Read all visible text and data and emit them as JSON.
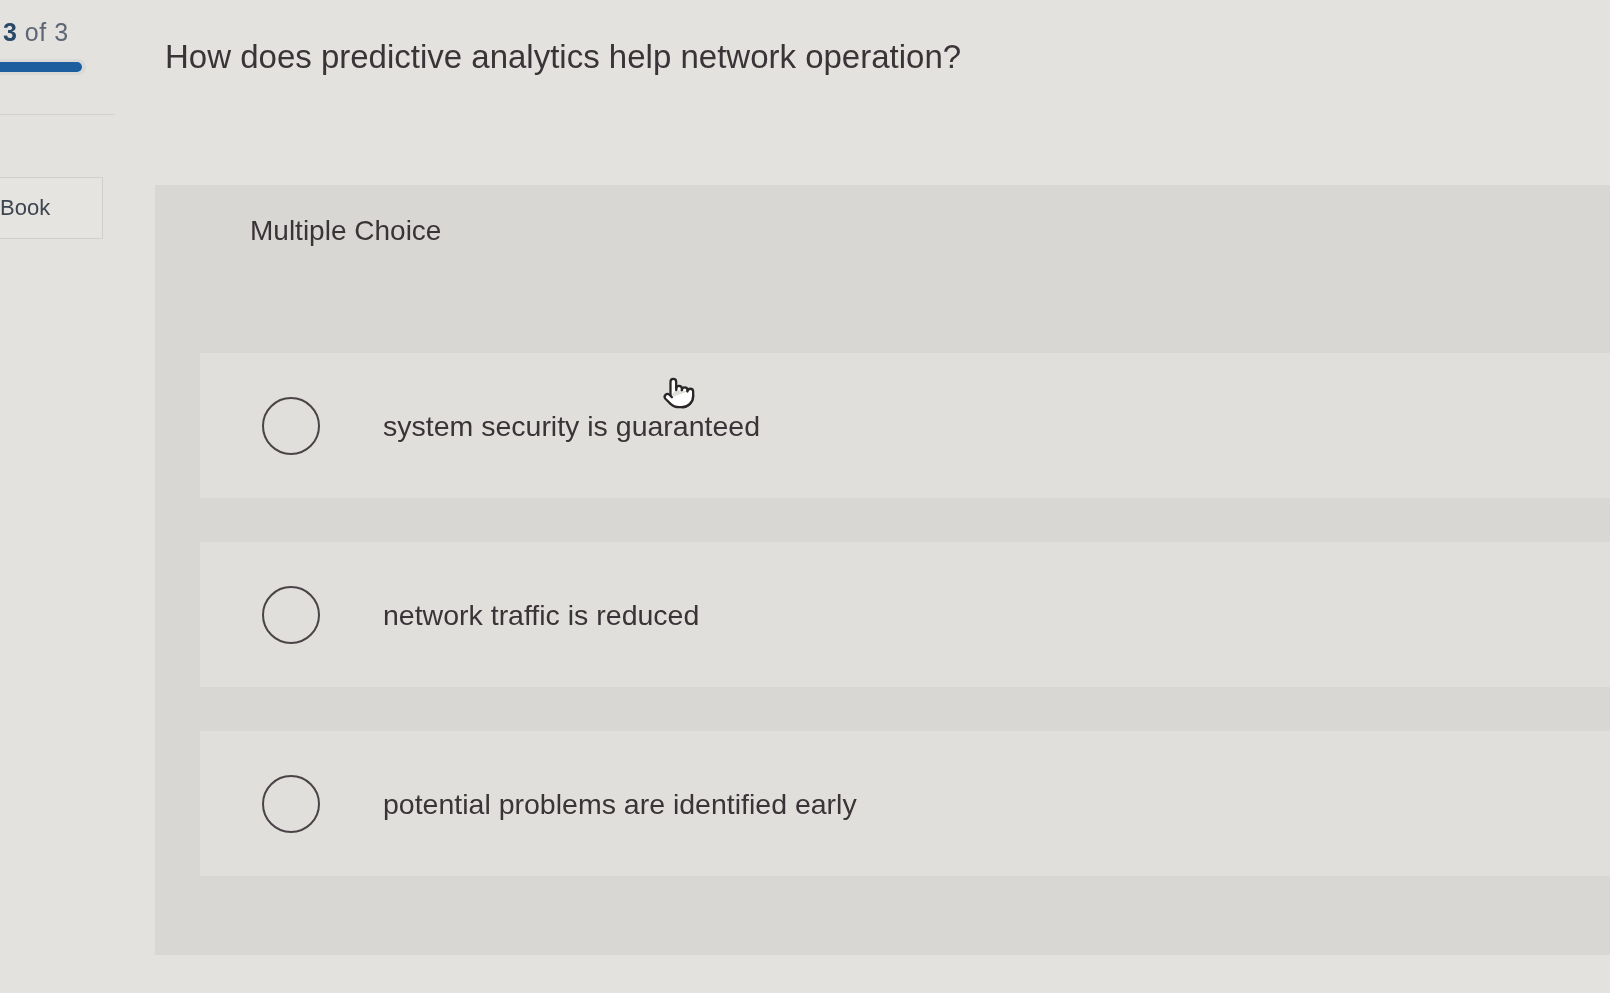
{
  "progress": {
    "counter": "**3** of 3",
    "level": 1
  },
  "sidebar": {
    "tab": "Book"
  },
  "question": {
    "text": "How does predictive analytics help network operation?"
  },
  "answer_panel": {
    "type_label": "Multiple Choice",
    "options": [
      {
        "text": "system security is guaranteed",
        "selected": false
      },
      {
        "text": "network traffic is reduced",
        "selected": false
      },
      {
        "text": "potential problems are identified early",
        "selected": false
      }
    ]
  }
}
